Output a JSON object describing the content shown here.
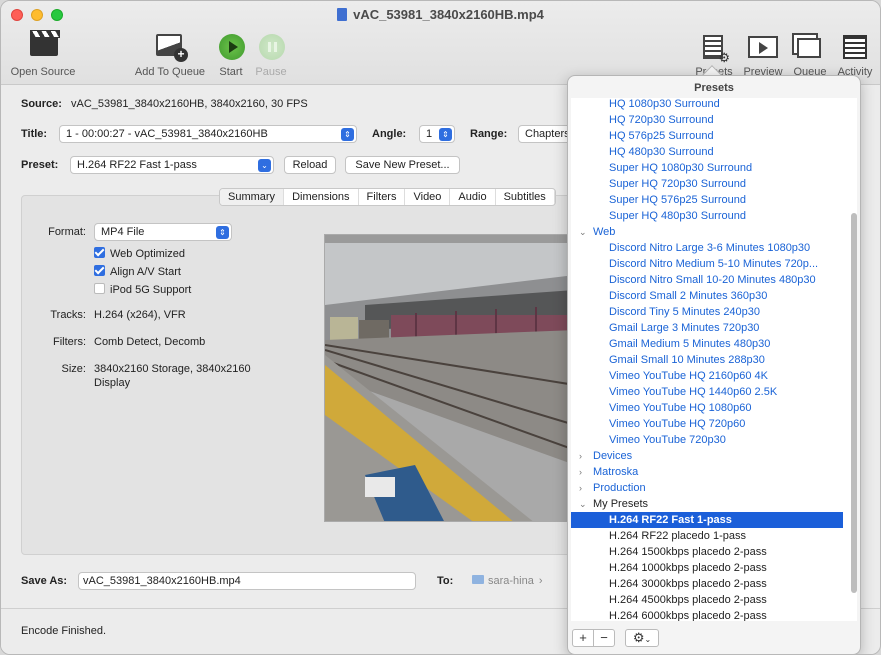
{
  "window": {
    "title": "vAC_53981_3840x2160HB.mp4"
  },
  "toolbar": {
    "open_source": "Open Source",
    "add_to_queue": "Add To Queue",
    "start": "Start",
    "pause": "Pause",
    "presets": "Presets",
    "preview": "Preview",
    "queue": "Queue",
    "activity": "Activity"
  },
  "source": {
    "label": "Source:",
    "value": "vAC_53981_3840x2160HB, 3840x2160, 30 FPS"
  },
  "title_row": {
    "label": "Title:",
    "value": "1 - 00:00:27 - vAC_53981_3840x2160HB",
    "angle_label": "Angle:",
    "angle_value": "1",
    "range_label": "Range:",
    "range_value": "Chapters"
  },
  "preset_row": {
    "label": "Preset:",
    "value": "H.264 RF22 Fast 1-pass",
    "reload": "Reload",
    "save_new": "Save New Preset..."
  },
  "tabs": [
    "Summary",
    "Dimensions",
    "Filters",
    "Video",
    "Audio",
    "Subtitles"
  ],
  "summary": {
    "format_label": "Format:",
    "format_value": "MP4 File",
    "web_optimized": "Web Optimized",
    "align_av": "Align A/V Start",
    "ipod": "iPod 5G Support",
    "tracks_label": "Tracks:",
    "tracks_value": "H.264 (x264), VFR",
    "filters_label": "Filters:",
    "filters_value": "Comb Detect, Decomb",
    "size_label": "Size:",
    "size_value_1": "3840x2160 Storage, 3840x2160",
    "size_value_2": "Display"
  },
  "save_as": {
    "label": "Save As:",
    "value": "vAC_53981_3840x2160HB.mp4",
    "to_label": "To:",
    "to_value": "sara-hina"
  },
  "status": {
    "text": "Encode Finished."
  },
  "presets_panel": {
    "title": "Presets",
    "items": [
      {
        "kind": "preset",
        "label": "HQ 1080p30 Surround"
      },
      {
        "kind": "preset",
        "label": "HQ 720p30 Surround"
      },
      {
        "kind": "preset",
        "label": "HQ 576p25 Surround"
      },
      {
        "kind": "preset",
        "label": "HQ 480p30 Surround"
      },
      {
        "kind": "preset",
        "label": "Super HQ 1080p30 Surround"
      },
      {
        "kind": "preset",
        "label": "Super HQ 720p30 Surround"
      },
      {
        "kind": "preset",
        "label": "Super HQ 576p25 Surround"
      },
      {
        "kind": "preset",
        "label": "Super HQ 480p30 Surround"
      },
      {
        "kind": "cat-open",
        "label": "Web"
      },
      {
        "kind": "preset",
        "label": "Discord Nitro Large 3-6 Minutes 1080p30"
      },
      {
        "kind": "preset",
        "label": "Discord Nitro Medium 5-10 Minutes 720p..."
      },
      {
        "kind": "preset",
        "label": "Discord Nitro Small 10-20 Minutes 480p30"
      },
      {
        "kind": "preset",
        "label": "Discord Small 2 Minutes 360p30"
      },
      {
        "kind": "preset",
        "label": "Discord Tiny 5 Minutes 240p30"
      },
      {
        "kind": "preset",
        "label": "Gmail Large 3 Minutes 720p30"
      },
      {
        "kind": "preset",
        "label": "Gmail Medium 5 Minutes 480p30"
      },
      {
        "kind": "preset",
        "label": "Gmail Small 10 Minutes 288p30"
      },
      {
        "kind": "preset",
        "label": "Vimeo YouTube HQ 2160p60 4K"
      },
      {
        "kind": "preset",
        "label": "Vimeo YouTube HQ 1440p60 2.5K"
      },
      {
        "kind": "preset",
        "label": "Vimeo YouTube HQ 1080p60"
      },
      {
        "kind": "preset",
        "label": "Vimeo YouTube HQ 720p60"
      },
      {
        "kind": "preset",
        "label": "Vimeo YouTube 720p30"
      },
      {
        "kind": "cat",
        "label": "Devices"
      },
      {
        "kind": "cat",
        "label": "Matroska"
      },
      {
        "kind": "cat",
        "label": "Production"
      },
      {
        "kind": "cat-open-dark",
        "label": "My Presets"
      },
      {
        "kind": "selected",
        "label": "H.264 RF22 Fast 1-pass"
      },
      {
        "kind": "mine",
        "label": "H.264 RF22 placedo 1-pass"
      },
      {
        "kind": "mine",
        "label": "H.264 1500kbps placedo 2-pass"
      },
      {
        "kind": "mine",
        "label": "H.264 1000kbps placedo 2-pass"
      },
      {
        "kind": "mine",
        "label": "H.264 3000kbps placedo 2-pass"
      },
      {
        "kind": "mine",
        "label": "H.264 4500kbps placedo 2-pass"
      },
      {
        "kind": "mine",
        "label": "H.264 6000kbps placedo 2-pass"
      }
    ],
    "footer": {
      "add": "+",
      "remove": "−",
      "gear": "⚙"
    }
  },
  "colors": {
    "accent": "#2f6ee0",
    "link": "#1a63d6",
    "selection": "#1b5fd9"
  }
}
